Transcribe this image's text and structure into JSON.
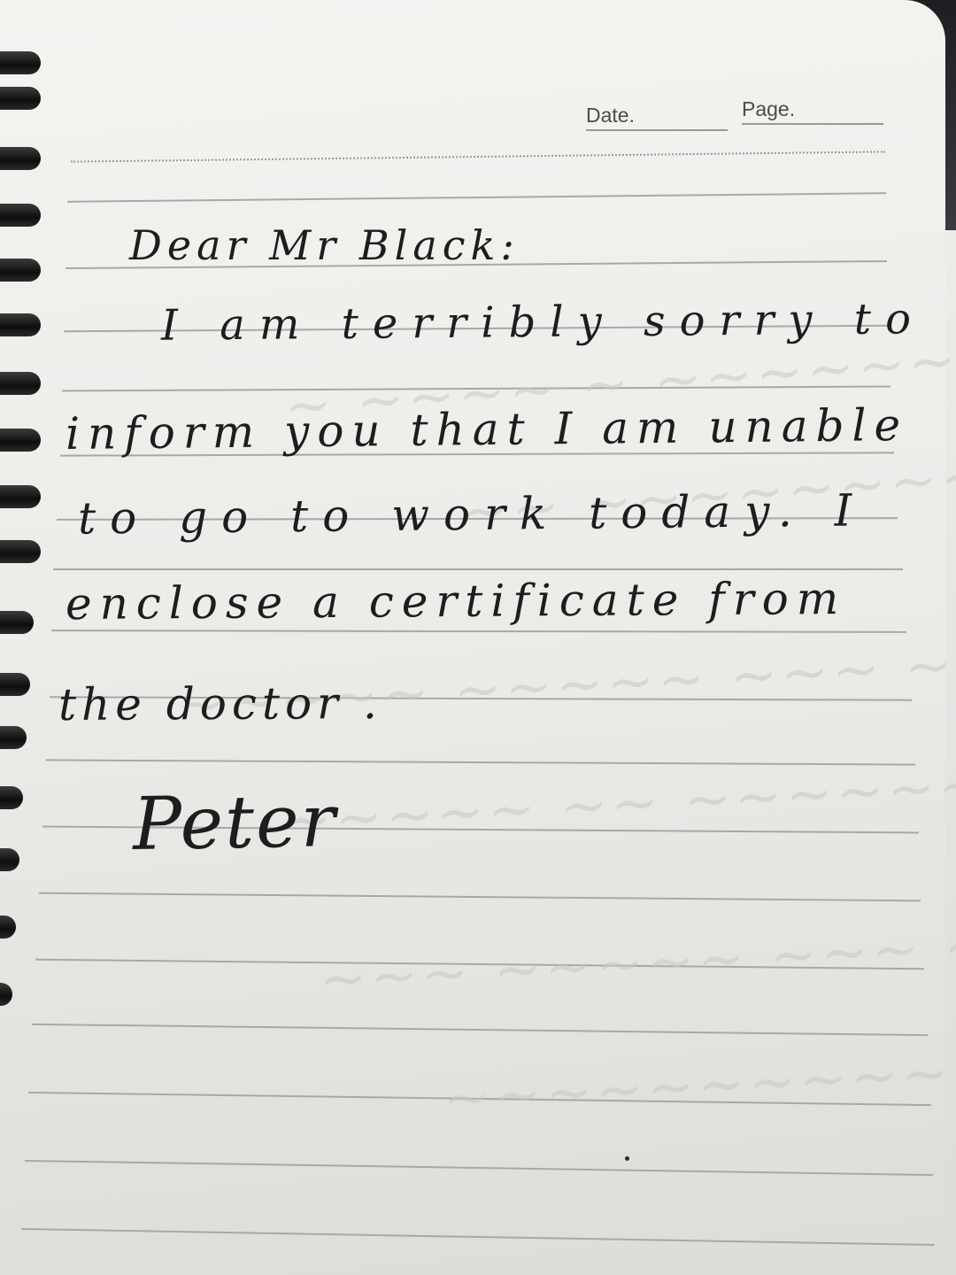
{
  "header": {
    "date_label": "Date.",
    "page_label": "Page."
  },
  "letter": {
    "salutation": "Dear Mr Black:",
    "lines": [
      "I am terribly sorry to",
      "inform you that I am unable",
      "to go to work today. I",
      "enclose a certificate from",
      "the doctor ."
    ],
    "signature": "Peter"
  },
  "colors": {
    "ink": "#1d1d1f",
    "paper": "#f4f3f0",
    "rule": "#a9a8a6",
    "spiral": "#111111"
  }
}
